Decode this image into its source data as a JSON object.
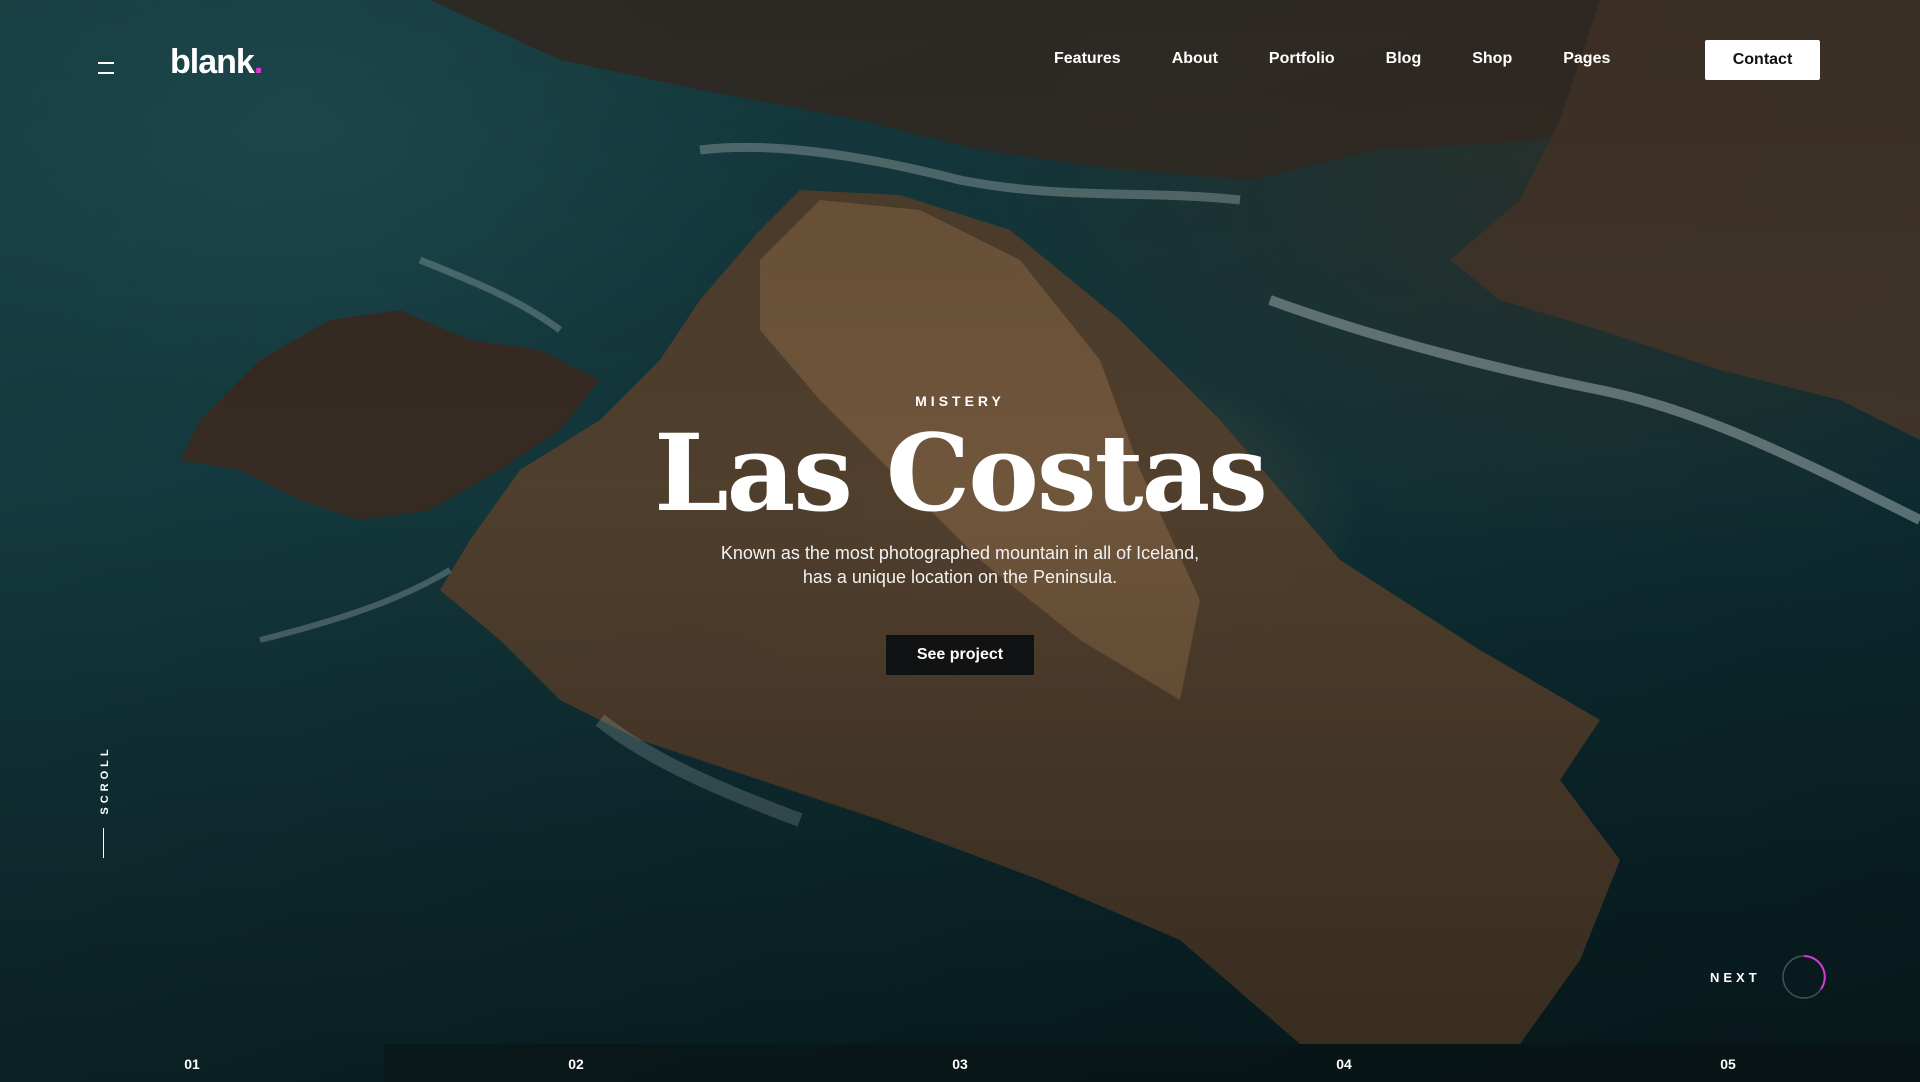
{
  "header": {
    "logo_text": "blank",
    "logo_dot": ".",
    "nav": [
      "Features",
      "About",
      "Portfolio",
      "Blog",
      "Shop",
      "Pages"
    ],
    "contact_label": "Contact"
  },
  "hero": {
    "eyebrow": "MISTERY",
    "title": "Las Costas",
    "description_line1": "Known as the most photographed mountain in all of Iceland,",
    "description_line2": "has a unique location on the Peninsula.",
    "cta_label": "See project"
  },
  "scroll_label": "SCROLL",
  "next_label": "NEXT",
  "pager": {
    "items": [
      "01",
      "02",
      "03",
      "04",
      "05"
    ],
    "active_index": 0
  },
  "colors": {
    "accent": "#d63ad6",
    "button_dark": "#111214",
    "contact_bg": "#ffffff"
  }
}
